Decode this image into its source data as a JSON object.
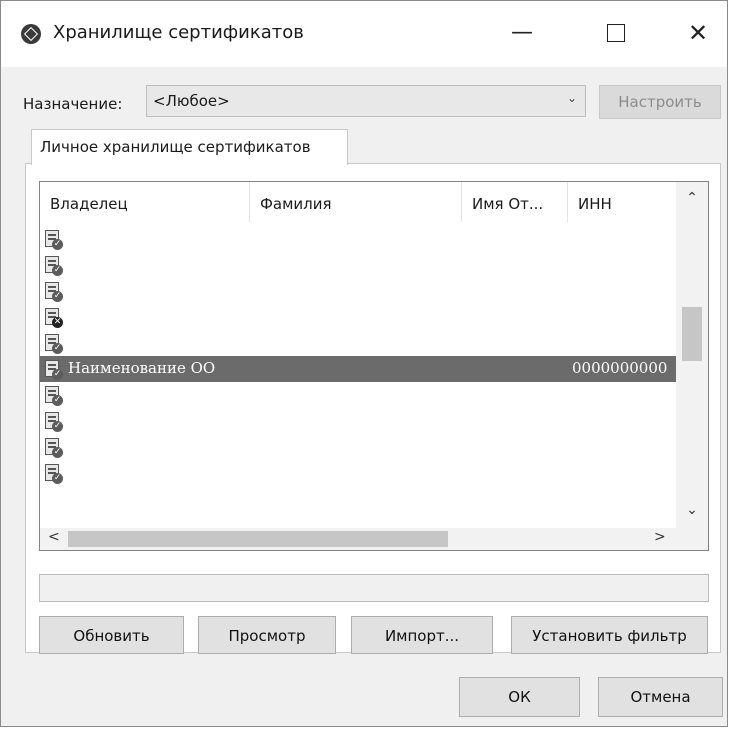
{
  "window": {
    "title": "Хранилище сертификатов",
    "minimize": "—",
    "close": "✕"
  },
  "purpose": {
    "label": "Назначение:",
    "value": "<Любое>",
    "setup_button": "Настроить"
  },
  "tab": {
    "label": "Личное хранилище сертификатов"
  },
  "list": {
    "columns": [
      "Владелец",
      "Фамилия",
      "Имя От...",
      "ИНН"
    ],
    "rows": [
      {
        "icon": "cert-icon",
        "owner": "",
        "inn": ""
      },
      {
        "icon": "cert-icon",
        "owner": "",
        "inn": ""
      },
      {
        "icon": "cert-icon",
        "owner": "",
        "inn": ""
      },
      {
        "icon": "cert-invalid-icon",
        "owner": "",
        "inn": ""
      },
      {
        "icon": "cert-icon",
        "owner": "",
        "inn": ""
      },
      {
        "icon": "cert-icon",
        "owner": "Наименование ОО",
        "inn": "0000000000",
        "selected": true
      },
      {
        "icon": "cert-icon",
        "owner": "",
        "inn": ""
      },
      {
        "icon": "cert-icon",
        "owner": "",
        "inn": ""
      },
      {
        "icon": "cert-icon",
        "owner": "",
        "inn": ""
      },
      {
        "icon": "cert-icon",
        "owner": "",
        "inn": ""
      }
    ]
  },
  "buttons": {
    "refresh": "Обновить",
    "view": "Просмотр",
    "import": "Импорт...",
    "filter": "Установить фильтр",
    "ok": "ОК",
    "cancel": "Отмена"
  },
  "colors": {
    "selected_row": "#6b6b6b",
    "dialog_bg": "#f0f0f0"
  }
}
